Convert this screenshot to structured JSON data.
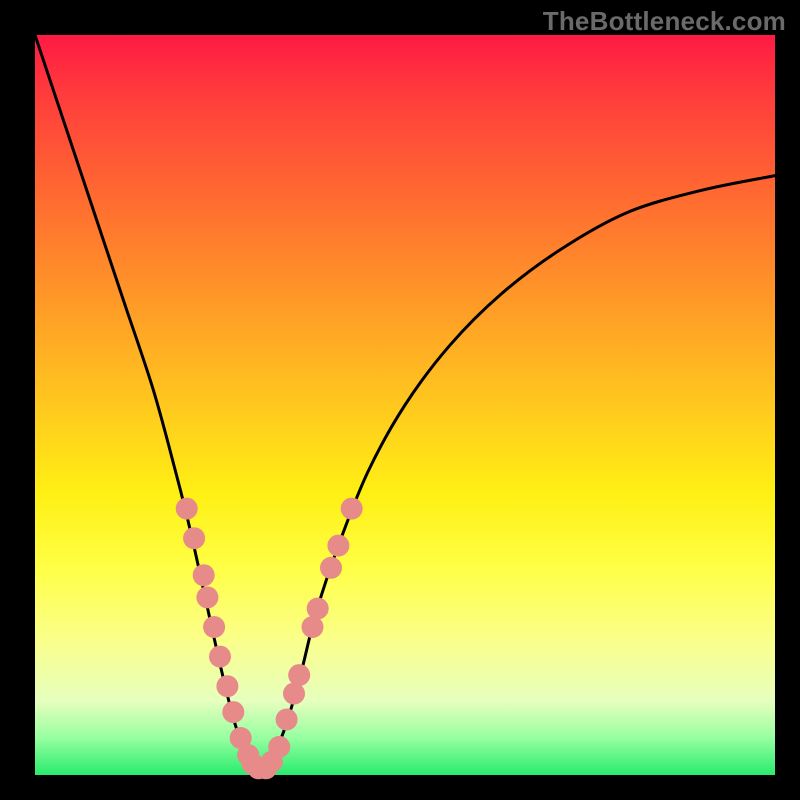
{
  "watermark": "TheBottleneck.com",
  "chart_data": {
    "type": "line",
    "title": "",
    "xlabel": "",
    "ylabel": "",
    "xlim": [
      0,
      100
    ],
    "ylim": [
      0,
      100
    ],
    "series": [
      {
        "name": "curve",
        "x": [
          0,
          4,
          8,
          12,
          16,
          19,
          21,
          23,
          25,
          27,
          29,
          30,
          31,
          32,
          34,
          36,
          38,
          41,
          45,
          50,
          56,
          63,
          71,
          80,
          90,
          100
        ],
        "y": [
          100,
          88,
          76,
          64,
          52,
          41,
          33,
          24,
          15,
          7,
          2,
          0.5,
          0.5,
          2,
          7,
          14,
          22,
          31,
          41,
          50,
          58,
          65,
          71,
          76,
          79,
          81
        ]
      }
    ],
    "markers": [
      {
        "x": 20.5,
        "y": 36
      },
      {
        "x": 21.5,
        "y": 32
      },
      {
        "x": 22.8,
        "y": 27
      },
      {
        "x": 23.3,
        "y": 24
      },
      {
        "x": 24.2,
        "y": 20
      },
      {
        "x": 25.0,
        "y": 16
      },
      {
        "x": 26.0,
        "y": 12
      },
      {
        "x": 26.8,
        "y": 8.5
      },
      {
        "x": 27.8,
        "y": 5
      },
      {
        "x": 28.8,
        "y": 2.7
      },
      {
        "x": 29.4,
        "y": 1.5
      },
      {
        "x": 30.2,
        "y": 0.9
      },
      {
        "x": 31.2,
        "y": 0.9
      },
      {
        "x": 32.0,
        "y": 1.8
      },
      {
        "x": 33.0,
        "y": 3.8
      },
      {
        "x": 34.0,
        "y": 7.5
      },
      {
        "x": 35.0,
        "y": 11
      },
      {
        "x": 35.7,
        "y": 13.5
      },
      {
        "x": 37.5,
        "y": 20
      },
      {
        "x": 38.2,
        "y": 22.5
      },
      {
        "x": 40.0,
        "y": 28
      },
      {
        "x": 41.0,
        "y": 31
      },
      {
        "x": 42.8,
        "y": 36
      }
    ],
    "marker_color": "#e68a8a",
    "marker_radius": 11
  }
}
